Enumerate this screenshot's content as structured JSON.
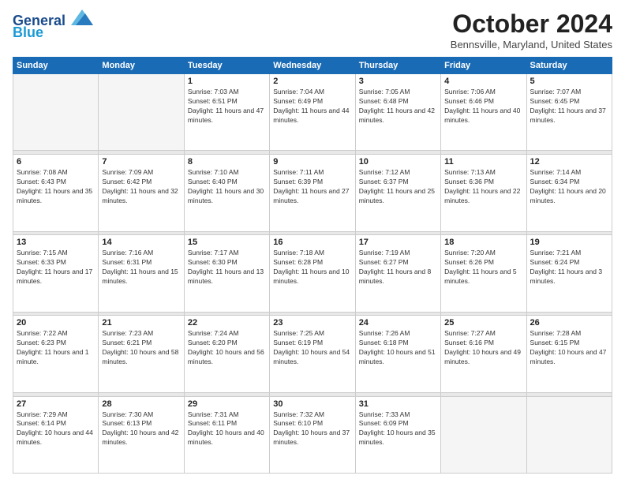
{
  "header": {
    "logo_line1": "General",
    "logo_line2": "Blue",
    "month": "October 2024",
    "location": "Bennsville, Maryland, United States"
  },
  "days_of_week": [
    "Sunday",
    "Monday",
    "Tuesday",
    "Wednesday",
    "Thursday",
    "Friday",
    "Saturday"
  ],
  "weeks": [
    [
      {
        "day": "",
        "info": ""
      },
      {
        "day": "",
        "info": ""
      },
      {
        "day": "1",
        "info": "Sunrise: 7:03 AM\nSunset: 6:51 PM\nDaylight: 11 hours and 47 minutes."
      },
      {
        "day": "2",
        "info": "Sunrise: 7:04 AM\nSunset: 6:49 PM\nDaylight: 11 hours and 44 minutes."
      },
      {
        "day": "3",
        "info": "Sunrise: 7:05 AM\nSunset: 6:48 PM\nDaylight: 11 hours and 42 minutes."
      },
      {
        "day": "4",
        "info": "Sunrise: 7:06 AM\nSunset: 6:46 PM\nDaylight: 11 hours and 40 minutes."
      },
      {
        "day": "5",
        "info": "Sunrise: 7:07 AM\nSunset: 6:45 PM\nDaylight: 11 hours and 37 minutes."
      }
    ],
    [
      {
        "day": "6",
        "info": "Sunrise: 7:08 AM\nSunset: 6:43 PM\nDaylight: 11 hours and 35 minutes."
      },
      {
        "day": "7",
        "info": "Sunrise: 7:09 AM\nSunset: 6:42 PM\nDaylight: 11 hours and 32 minutes."
      },
      {
        "day": "8",
        "info": "Sunrise: 7:10 AM\nSunset: 6:40 PM\nDaylight: 11 hours and 30 minutes."
      },
      {
        "day": "9",
        "info": "Sunrise: 7:11 AM\nSunset: 6:39 PM\nDaylight: 11 hours and 27 minutes."
      },
      {
        "day": "10",
        "info": "Sunrise: 7:12 AM\nSunset: 6:37 PM\nDaylight: 11 hours and 25 minutes."
      },
      {
        "day": "11",
        "info": "Sunrise: 7:13 AM\nSunset: 6:36 PM\nDaylight: 11 hours and 22 minutes."
      },
      {
        "day": "12",
        "info": "Sunrise: 7:14 AM\nSunset: 6:34 PM\nDaylight: 11 hours and 20 minutes."
      }
    ],
    [
      {
        "day": "13",
        "info": "Sunrise: 7:15 AM\nSunset: 6:33 PM\nDaylight: 11 hours and 17 minutes."
      },
      {
        "day": "14",
        "info": "Sunrise: 7:16 AM\nSunset: 6:31 PM\nDaylight: 11 hours and 15 minutes."
      },
      {
        "day": "15",
        "info": "Sunrise: 7:17 AM\nSunset: 6:30 PM\nDaylight: 11 hours and 13 minutes."
      },
      {
        "day": "16",
        "info": "Sunrise: 7:18 AM\nSunset: 6:28 PM\nDaylight: 11 hours and 10 minutes."
      },
      {
        "day": "17",
        "info": "Sunrise: 7:19 AM\nSunset: 6:27 PM\nDaylight: 11 hours and 8 minutes."
      },
      {
        "day": "18",
        "info": "Sunrise: 7:20 AM\nSunset: 6:26 PM\nDaylight: 11 hours and 5 minutes."
      },
      {
        "day": "19",
        "info": "Sunrise: 7:21 AM\nSunset: 6:24 PM\nDaylight: 11 hours and 3 minutes."
      }
    ],
    [
      {
        "day": "20",
        "info": "Sunrise: 7:22 AM\nSunset: 6:23 PM\nDaylight: 11 hours and 1 minute."
      },
      {
        "day": "21",
        "info": "Sunrise: 7:23 AM\nSunset: 6:21 PM\nDaylight: 10 hours and 58 minutes."
      },
      {
        "day": "22",
        "info": "Sunrise: 7:24 AM\nSunset: 6:20 PM\nDaylight: 10 hours and 56 minutes."
      },
      {
        "day": "23",
        "info": "Sunrise: 7:25 AM\nSunset: 6:19 PM\nDaylight: 10 hours and 54 minutes."
      },
      {
        "day": "24",
        "info": "Sunrise: 7:26 AM\nSunset: 6:18 PM\nDaylight: 10 hours and 51 minutes."
      },
      {
        "day": "25",
        "info": "Sunrise: 7:27 AM\nSunset: 6:16 PM\nDaylight: 10 hours and 49 minutes."
      },
      {
        "day": "26",
        "info": "Sunrise: 7:28 AM\nSunset: 6:15 PM\nDaylight: 10 hours and 47 minutes."
      }
    ],
    [
      {
        "day": "27",
        "info": "Sunrise: 7:29 AM\nSunset: 6:14 PM\nDaylight: 10 hours and 44 minutes."
      },
      {
        "day": "28",
        "info": "Sunrise: 7:30 AM\nSunset: 6:13 PM\nDaylight: 10 hours and 42 minutes."
      },
      {
        "day": "29",
        "info": "Sunrise: 7:31 AM\nSunset: 6:11 PM\nDaylight: 10 hours and 40 minutes."
      },
      {
        "day": "30",
        "info": "Sunrise: 7:32 AM\nSunset: 6:10 PM\nDaylight: 10 hours and 37 minutes."
      },
      {
        "day": "31",
        "info": "Sunrise: 7:33 AM\nSunset: 6:09 PM\nDaylight: 10 hours and 35 minutes."
      },
      {
        "day": "",
        "info": ""
      },
      {
        "day": "",
        "info": ""
      }
    ]
  ]
}
